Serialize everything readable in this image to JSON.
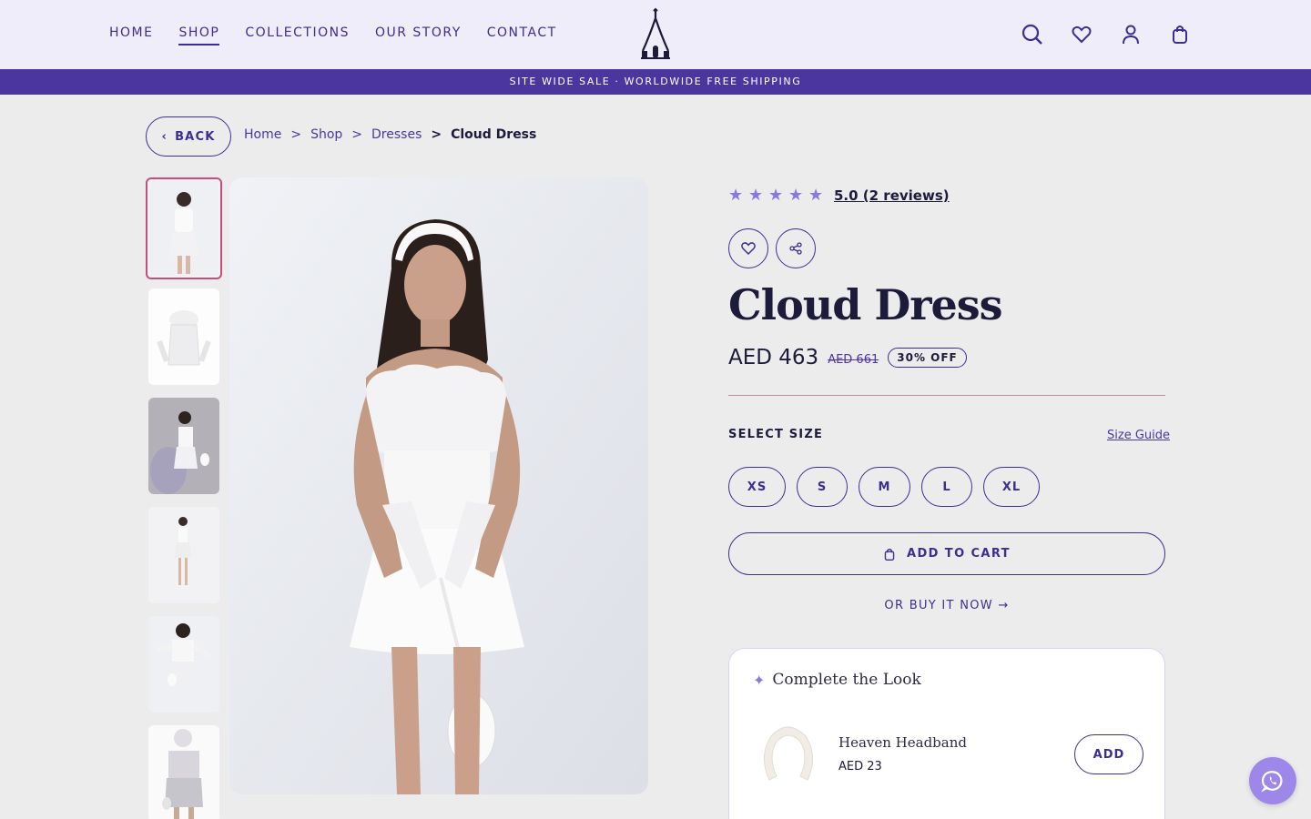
{
  "nav": {
    "items": [
      {
        "label": "HOME",
        "active": false
      },
      {
        "label": "SHOP",
        "active": true
      },
      {
        "label": "COLLECTIONS",
        "active": false
      },
      {
        "label": "OUR STORY",
        "active": false
      },
      {
        "label": "CONTACT",
        "active": false
      }
    ]
  },
  "header": {
    "icons": [
      "search-icon",
      "heart-icon",
      "user-icon",
      "bag-icon"
    ]
  },
  "promo": {
    "text": "SITE WIDE SALE · WORLDWIDE FREE SHIPPING"
  },
  "breadcrumb": {
    "back_label": "BACK",
    "items": [
      "Home",
      "Shop",
      "Dresses"
    ],
    "separator": ">",
    "current": "Cloud Dress"
  },
  "product": {
    "rating_text": "5.0 (2 reviews)",
    "stars": 5,
    "title": "Cloud Dress",
    "price": "AED 463",
    "price_was": "AED 661",
    "discount": "30% OFF",
    "size_label": "SELECT SIZE",
    "size_guide": "Size Guide",
    "sizes": [
      "XS",
      "S",
      "M",
      "L",
      "XL"
    ],
    "add_to_cart": "ADD TO CART",
    "buy_now": "OR BUY IT NOW →"
  },
  "complete_look": {
    "title": "Complete the Look",
    "item_name": "Heaven Headband",
    "item_price": "AED 23",
    "add_label": "ADD"
  },
  "colors": {
    "accent": "#3b2f8f",
    "promo_bg": "#4b36a0",
    "star": "#8a78e0",
    "selected_thumb_border": "#c94d7a"
  }
}
